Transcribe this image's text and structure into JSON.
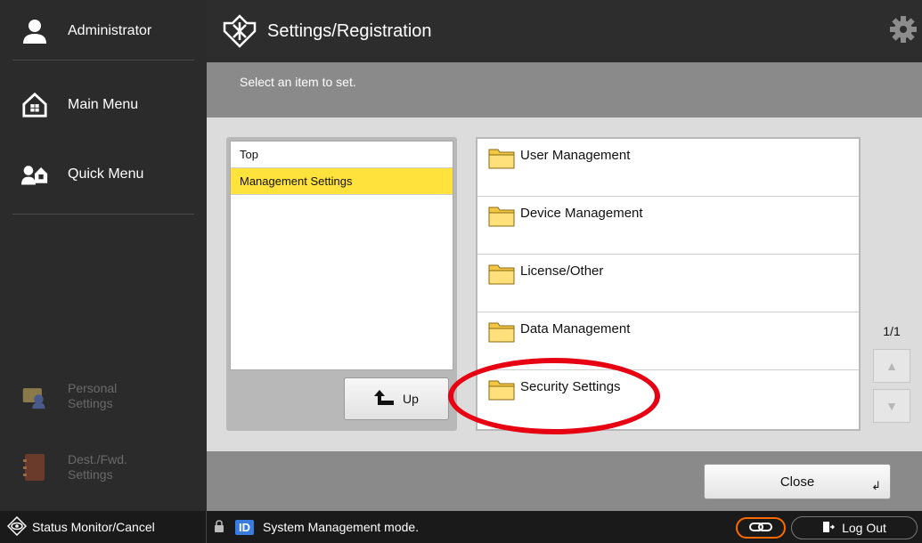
{
  "sidebar": {
    "user": {
      "label": "Administrator",
      "icon": "user-icon"
    },
    "main_menu": {
      "label": "Main Menu",
      "icon": "home-icon"
    },
    "quick_menu": {
      "label": "Quick Menu",
      "icon": "quick-menu-icon"
    },
    "personal_settings": {
      "label_line1": "Personal",
      "label_line2": "Settings",
      "icon": "personal-settings-icon"
    },
    "dest_settings": {
      "label_line1": "Dest./Fwd.",
      "label_line2": "Settings",
      "icon": "address-book-icon"
    }
  },
  "header": {
    "title": "Settings/Registration",
    "icon": "settings-registration-icon",
    "gear_icon": "gear-icon"
  },
  "instruction": "Select an item to set.",
  "tree": {
    "items": [
      {
        "label": "Top",
        "selected": false
      },
      {
        "label": "Management Settings",
        "selected": true
      }
    ],
    "up_button": "Up"
  },
  "items": [
    {
      "label": "User Management",
      "icon": "folder-icon"
    },
    {
      "label": "Device Management",
      "icon": "folder-icon"
    },
    {
      "label": "License/Other",
      "icon": "folder-icon"
    },
    {
      "label": "Data Management",
      "icon": "folder-icon"
    },
    {
      "label": "Security Settings",
      "icon": "folder-icon",
      "highlighted": true
    }
  ],
  "pager": {
    "text": "1/1"
  },
  "close_button": "Close",
  "statusbar": {
    "status_monitor": "Status Monitor/Cancel",
    "id_badge": "ID",
    "system_message": "System Management mode.",
    "logout": "Log Out"
  },
  "colors": {
    "selected_row": "#ffe23b",
    "highlight_ring": "#e60012",
    "link_pill": "#ff6a00",
    "id_badge": "#3a7be0"
  }
}
